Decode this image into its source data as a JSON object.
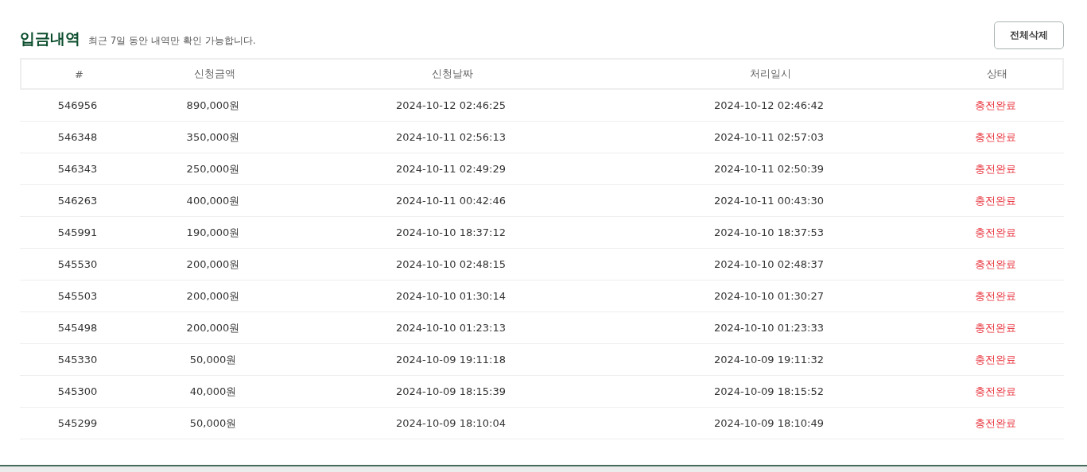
{
  "header": {
    "title": "입금내역",
    "note": "최근 7일 동안 내역만 확인 가능합니다.",
    "delete_button": "전체삭제"
  },
  "table": {
    "columns": [
      "#",
      "신청금액",
      "신청날짜",
      "처리일시",
      "상태"
    ],
    "rows": [
      [
        "546956",
        "890,000원",
        "2024-10-12 02:46:25",
        "2024-10-12 02:46:42",
        "충전완료"
      ],
      [
        "546348",
        "350,000원",
        "2024-10-11 02:56:13",
        "2024-10-11 02:57:03",
        "충전완료"
      ],
      [
        "546343",
        "250,000원",
        "2024-10-11 02:49:29",
        "2024-10-11 02:50:39",
        "충전완료"
      ],
      [
        "546263",
        "400,000원",
        "2024-10-11 00:42:46",
        "2024-10-11 00:43:30",
        "충전완료"
      ],
      [
        "545991",
        "190,000원",
        "2024-10-10 18:37:12",
        "2024-10-10 18:37:53",
        "충전완료"
      ],
      [
        "545530",
        "200,000원",
        "2024-10-10 02:48:15",
        "2024-10-10 02:48:37",
        "충전완료"
      ],
      [
        "545503",
        "200,000원",
        "2024-10-10 01:30:14",
        "2024-10-10 01:30:27",
        "충전완료"
      ],
      [
        "545498",
        "200,000원",
        "2024-10-10 01:23:13",
        "2024-10-10 01:23:33",
        "충전완료"
      ],
      [
        "545330",
        "50,000원",
        "2024-10-09 19:11:18",
        "2024-10-09 19:11:32",
        "충전완료"
      ],
      [
        "545300",
        "40,000원",
        "2024-10-09 18:15:39",
        "2024-10-09 18:15:52",
        "충전완료"
      ],
      [
        "545299",
        "50,000원",
        "2024-10-09 18:10:04",
        "2024-10-09 18:10:49",
        "충전완료"
      ]
    ]
  }
}
